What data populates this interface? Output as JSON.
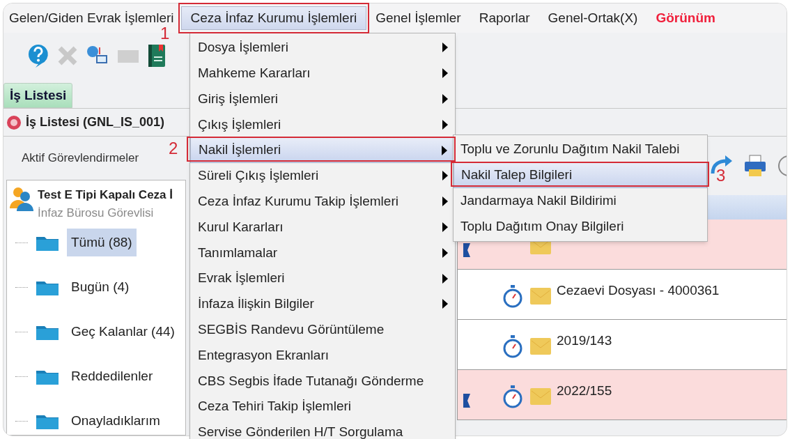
{
  "menubar": [
    {
      "label": "Gelen/Giden Evrak İşlemleri",
      "selected": false,
      "emphasis": false
    },
    {
      "label": "Ceza İnfaz Kurumu İşlemleri",
      "selected": true,
      "emphasis": false
    },
    {
      "label": "Genel İşlemler",
      "selected": false,
      "emphasis": false
    },
    {
      "label": "Raporlar",
      "selected": false,
      "emphasis": false
    },
    {
      "label": "Genel-Ortak(X)",
      "selected": false,
      "emphasis": false
    },
    {
      "label": "Görünüm",
      "selected": false,
      "emphasis": true
    }
  ],
  "callouts": [
    "1",
    "2",
    "3"
  ],
  "tab": {
    "label": "İş Listesi",
    "selected": true
  },
  "panel_title": "İş Listesi (GNL_IS_001)",
  "section_label": "Aktif Görevlendirmeler",
  "tree": {
    "user": "Test E Tipi Kapalı Ceza İ",
    "role": "İnfaz Bürosu Görevlisi",
    "items": [
      {
        "label": "Tümü (88)",
        "selected": true
      },
      {
        "label": "Bugün (4)",
        "selected": false
      },
      {
        "label": "Geç Kalanlar (44)",
        "selected": false
      },
      {
        "label": "Reddedilenler",
        "selected": false
      },
      {
        "label": "Onayladıklarım",
        "selected": false
      }
    ]
  },
  "rows": [
    {
      "text": null,
      "highlighted": true,
      "flagged": true,
      "timer": false
    },
    {
      "text": "Cezaevi Dosyası - 4000361",
      "highlighted": false,
      "flagged": false,
      "timer": true
    },
    {
      "text": "2019/143",
      "highlighted": false,
      "flagged": false,
      "timer": true
    },
    {
      "text": "2022/155",
      "highlighted": true,
      "flagged": true,
      "timer": true
    }
  ],
  "menu": {
    "items": [
      {
        "label": "Dosya İşlemleri",
        "submenu": true,
        "selected": false
      },
      {
        "label": "Mahkeme Kararları",
        "submenu": true,
        "selected": false
      },
      {
        "label": "Giriş İşlemleri",
        "submenu": true,
        "selected": false
      },
      {
        "label": "Çıkış İşlemleri",
        "submenu": true,
        "selected": false
      },
      {
        "label": "Nakil İşlemleri",
        "submenu": true,
        "selected": true
      },
      {
        "label": "Süreli Çıkış İşlemleri",
        "submenu": true,
        "selected": false
      },
      {
        "label": "Ceza İnfaz Kurumu Takip İşlemleri",
        "submenu": true,
        "selected": false
      },
      {
        "label": "Kurul Kararları",
        "submenu": true,
        "selected": false
      },
      {
        "label": "Tanımlamalar",
        "submenu": true,
        "selected": false
      },
      {
        "label": "Evrak İşlemleri",
        "submenu": true,
        "selected": false
      },
      {
        "label": "İnfaza İlişkin Bilgiler",
        "submenu": true,
        "selected": false
      },
      {
        "label": "SEGBİS Randevu Görüntüleme",
        "submenu": false,
        "selected": false
      },
      {
        "label": "Entegrasyon Ekranları",
        "submenu": false,
        "selected": false
      },
      {
        "label": "CBS Segbis İfade Tutanağı Gönderme",
        "submenu": false,
        "selected": false
      },
      {
        "label": "Ceza Tehiri Takip İşlemleri",
        "submenu": false,
        "selected": false
      },
      {
        "label": "Servise Gönderilen H/T Sorgulama",
        "submenu": false,
        "selected": false
      }
    ]
  },
  "submenu": {
    "items": [
      {
        "label": "Toplu ve Zorunlu Dağıtım Nakil Talebi",
        "selected": false
      },
      {
        "label": "Nakil Talep Bilgileri",
        "selected": true
      },
      {
        "label": "Jandarmaya Nakil Bildirimi",
        "selected": false
      },
      {
        "label": "Toplu Dağıtım Onay Bilgileri",
        "selected": false
      }
    ]
  }
}
